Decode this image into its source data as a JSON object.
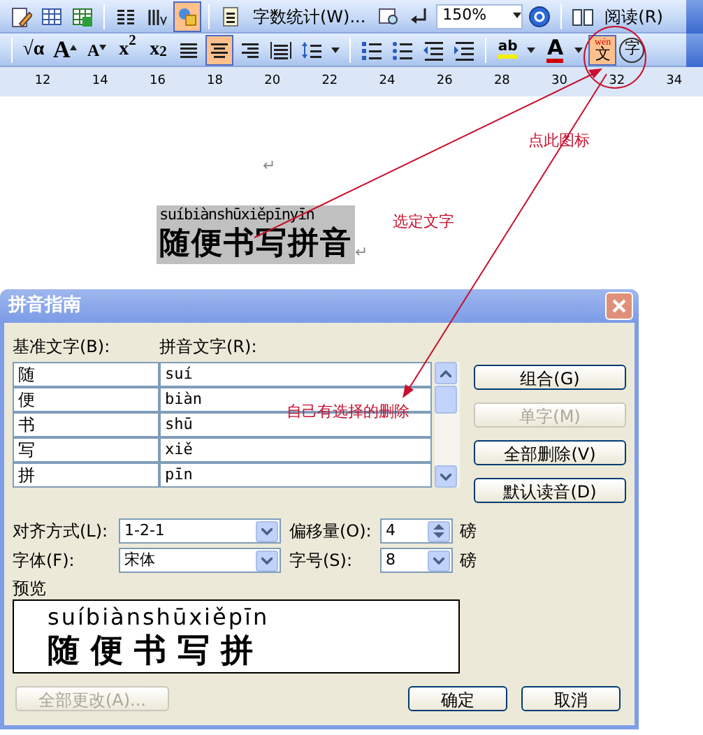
{
  "toolbar_top": [
    {
      "kind": "edit",
      "selected": false
    },
    {
      "kind": "table",
      "selected": false
    },
    {
      "kind": "sheet",
      "selected": false
    },
    {
      "kind": "sep"
    },
    {
      "kind": "columns",
      "selected": false
    },
    {
      "kind": "direction",
      "selected": false
    },
    {
      "kind": "drawing",
      "selected": true
    },
    {
      "kind": "sep"
    },
    {
      "kind": "page",
      "selected": false
    },
    {
      "kind": "command",
      "label": "字数统计(W)..."
    },
    {
      "kind": "preview",
      "selected": false
    },
    {
      "kind": "return",
      "selected": false
    },
    {
      "kind": "zoom",
      "value": "150%"
    },
    {
      "kind": "help",
      "selected": false
    },
    {
      "kind": "sep"
    },
    {
      "kind": "book",
      "selected": false
    },
    {
      "kind": "command",
      "label": "阅读(R)"
    }
  ],
  "toolbar_format": [
    {
      "kind": "sep"
    },
    {
      "kind": "glyph",
      "text": "√α",
      "selected": false
    },
    {
      "kind": "grow",
      "text": "A",
      "selected": false
    },
    {
      "kind": "shrink",
      "text": "A",
      "selected": false
    },
    {
      "kind": "glyph",
      "text": "x$^{2}$",
      "selected": false
    },
    {
      "kind": "glyph",
      "text": "x$_{2}$",
      "selected": false
    },
    {
      "kind": "justify",
      "selected": false
    },
    {
      "kind": "center",
      "selected": true
    },
    {
      "kind": "right",
      "selected": false
    },
    {
      "kind": "distribute",
      "selected": false
    },
    {
      "kind": "spacing",
      "selected": false
    },
    {
      "kind": "sep"
    },
    {
      "kind": "numbering",
      "selected": false
    },
    {
      "kind": "bullets",
      "selected": false
    },
    {
      "kind": "outdent",
      "selected": false
    },
    {
      "kind": "indent",
      "selected": false
    },
    {
      "kind": "sep"
    },
    {
      "kind": "highlight",
      "text": "ab",
      "selected": false
    },
    {
      "kind": "fontcolor",
      "text": "A",
      "selected": false
    },
    {
      "kind": "phonetic",
      "ruby": "wén",
      "text": "文",
      "selected": true
    },
    {
      "kind": "enclose",
      "text": "字",
      "selected": false
    }
  ],
  "ruler": [
    "12",
    "14",
    "16",
    "18",
    "20",
    "22",
    "24",
    "26",
    "28",
    "30",
    "32",
    "34"
  ],
  "document": {
    "empty_mark": "↵",
    "ruby": "suíbiànshūxiěpīnyīn",
    "base": "随便书写拼音",
    "selected": true,
    "end_mark": "↵"
  },
  "annotations": [
    {
      "text": "点此图标"
    },
    {
      "text": "选定文字"
    },
    {
      "text": "自己有选择的删除"
    }
  ],
  "dialog": {
    "title": "拼音指南",
    "base_label": "基准文字(B):",
    "ruby_label": "拼音文字(R):",
    "rows": [
      {
        "base": "随",
        "ruby": "suí"
      },
      {
        "base": "便",
        "ruby": "biàn"
      },
      {
        "base": "书",
        "ruby": "shū"
      },
      {
        "base": "写",
        "ruby": "xiě"
      },
      {
        "base": "拼",
        "ruby": "pīn"
      }
    ],
    "side_buttons": [
      {
        "label": "组合(G)",
        "disabled": false
      },
      {
        "label": "单字(M)",
        "disabled": true
      },
      {
        "label": "全部删除(V)",
        "disabled": false
      },
      {
        "label": "默认读音(D)",
        "disabled": false
      }
    ],
    "alignment": {
      "label": "对齐方式(L):",
      "value": "1-2-1"
    },
    "offset": {
      "label": "偏移量(O):",
      "value": "4",
      "unit": "磅"
    },
    "font": {
      "label": "字体(F):",
      "value": "宋体"
    },
    "size": {
      "label": "字号(S):",
      "value": "8",
      "unit": "磅"
    },
    "preview": {
      "label": "预览",
      "ruby": "suíbiànshūxiěpīn",
      "base": "随便书写拼"
    },
    "apply_all": {
      "label": "全部更改(A)...",
      "disabled": true
    },
    "ok": "确定",
    "cancel": "取消"
  }
}
